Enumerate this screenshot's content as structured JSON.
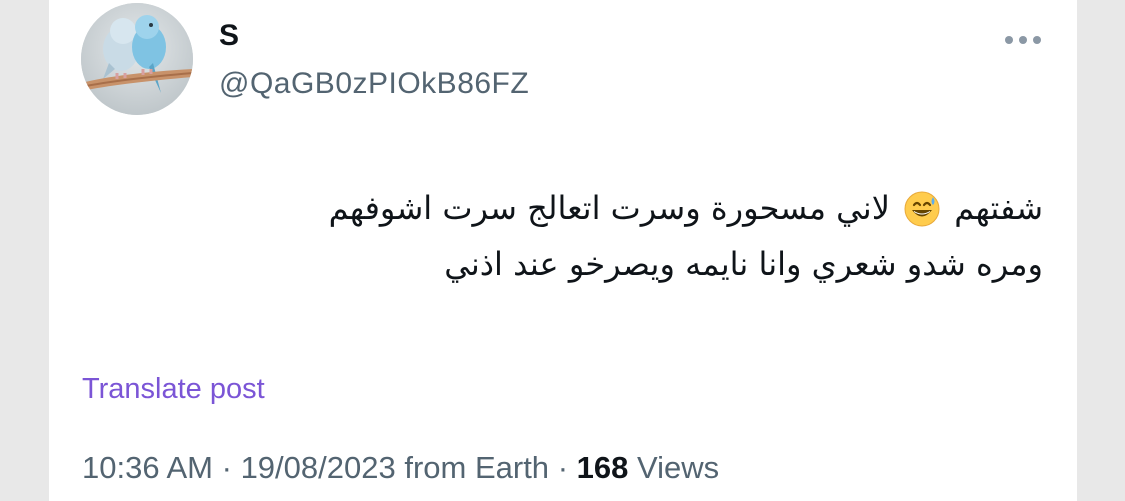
{
  "author": {
    "display_name": "S",
    "handle": "@QaGB0zPIOkB86FZ",
    "avatar_icon": "parakeets-avatar"
  },
  "more_icon": "more-horizontal-icon",
  "tweet": {
    "line1_before_emoji": "شفتهم",
    "emoji": "grinning-face-with-sweat-icon",
    "line1_after_emoji": "لاني مسحورة وسرت اتعالج سرت اشوفهم",
    "line2": "ومره شدو شعري وانا نايمه ويصرخو عند اذني"
  },
  "translate_label": "Translate post",
  "meta": {
    "time": "10:36 AM",
    "separator": "·",
    "date": "19/08/2023",
    "source": "from Earth",
    "views_count": "168",
    "views_label": "Views"
  },
  "colors": {
    "text": "#0f1419",
    "secondary": "#536471",
    "translate": "#7b55d6",
    "background": "#ffffff",
    "sides": "#e8e8e8"
  }
}
